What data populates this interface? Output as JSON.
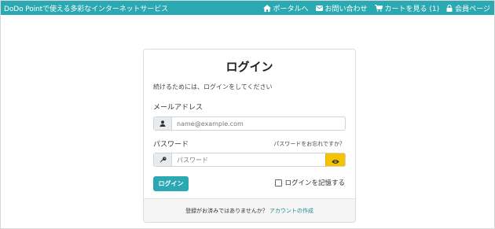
{
  "header": {
    "brand": "DoDo Pointで使える多彩なインターネットサービス",
    "nav": [
      {
        "icon": "home-icon",
        "label": "ポータルへ"
      },
      {
        "icon": "envelope-icon",
        "label": "お問い合わせ"
      },
      {
        "icon": "cart-icon",
        "label": "カートを見る (1)"
      },
      {
        "icon": "lock-icon",
        "label": "会員ページ"
      }
    ]
  },
  "login": {
    "title": "ログイン",
    "lead": "続けるためには、ログインをしてください",
    "email_label": "メールアドレス",
    "email_placeholder": "name@example.com",
    "email_value": "",
    "password_label": "パスワード",
    "forgot_link": "パスワードをお忘れですか？",
    "password_placeholder": "パスワード",
    "password_value": "",
    "submit_label": "ログイン",
    "remember_label": "ログインを記憶する",
    "remember_checked": false,
    "footer_text": "登録がお済みではありませんか？",
    "register_link": "アカウントの作成"
  },
  "colors": {
    "accent": "#2aa9b2",
    "password_toggle": "#f5c400"
  }
}
